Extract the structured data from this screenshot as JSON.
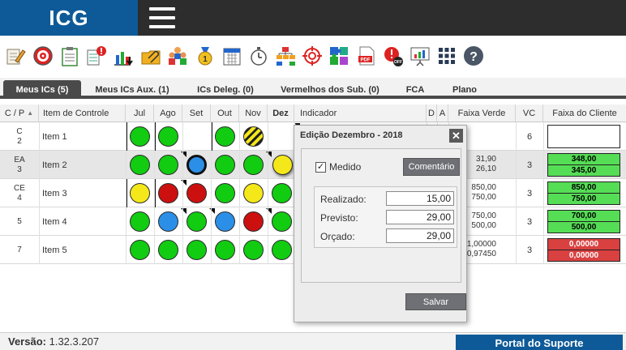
{
  "app": {
    "logo": "ICG"
  },
  "toolbar": {
    "icons": [
      "edit-icon",
      "target-icon",
      "clipboard-icon",
      "alert-chart-icon",
      "bar-chart-icon",
      "folder-clip-icon",
      "team-icon",
      "medal-icon",
      "calendar-icon",
      "stopwatch-icon",
      "org-chart-icon",
      "crosshair-icon",
      "puzzle-icon",
      "pdf-icon",
      "alert-off-icon",
      "presentation-icon",
      "grid-icon",
      "help-icon"
    ]
  },
  "tabs": [
    {
      "label": "Meus ICs (5)",
      "active": true
    },
    {
      "label": "Meus ICs Aux. (1)",
      "active": false
    },
    {
      "label": "ICs Deleg. (0)",
      "active": false
    },
    {
      "label": "Vermelhos dos Sub. (0)",
      "active": false
    },
    {
      "label": "FCA",
      "active": false
    },
    {
      "label": "Plano",
      "active": false
    }
  ],
  "grid": {
    "columns": {
      "cp": "C / P",
      "item": "Item de Controle",
      "jul": "Jul",
      "ago": "Ago",
      "set": "Set",
      "out": "Out",
      "nov": "Nov",
      "dez": "Dez",
      "indicador": "Indicador",
      "d": "D",
      "a": "A",
      "faixa_verde": "Faixa Verde",
      "vc": "VC",
      "faixa_cliente": "Faixa do Cliente"
    },
    "rows": [
      {
        "c": "C",
        "p": "2",
        "item": "Item 1",
        "months": [
          "green",
          "green",
          "empty",
          "green",
          "hatched",
          "empty"
        ],
        "fv": [
          "",
          ""
        ],
        "vc": "6",
        "cliente": {
          "top": "",
          "bottom": "",
          "color": "#ffffff",
          "single": true
        }
      },
      {
        "c": "EA",
        "p": "3",
        "item": "Item 2",
        "months": [
          "green",
          "green",
          "blue-selected",
          "green",
          "green",
          "yellow"
        ],
        "fv": [
          "31,90",
          "26,10"
        ],
        "vc": "3",
        "cliente": {
          "top": "348,00",
          "bottom": "345,00",
          "color": "#55dd55",
          "single": false
        }
      },
      {
        "c": "CE",
        "p": "4",
        "item": "Item 3",
        "months": [
          "yellow",
          "red",
          "red",
          "green",
          "yellow",
          "green"
        ],
        "fv": [
          "850,00",
          "750,00"
        ],
        "vc": "3",
        "cliente": {
          "top": "850,00",
          "bottom": "750,00",
          "color": "#55dd55",
          "single": false
        }
      },
      {
        "c": "",
        "p": "5",
        "item": "Item 4",
        "months": [
          "green",
          "blue",
          "green",
          "blue",
          "red",
          "green"
        ],
        "fv": [
          "750,00",
          "500,00"
        ],
        "vc": "3",
        "cliente": {
          "top": "700,00",
          "bottom": "500,00",
          "color": "#55dd55",
          "single": false
        }
      },
      {
        "c": "",
        "p": "7",
        "item": "Item 5",
        "months": [
          "green",
          "green",
          "green",
          "green",
          "green",
          "green"
        ],
        "fv": [
          "1,00000",
          "0,97450"
        ],
        "vc": "3",
        "cliente": {
          "top": "0,00000",
          "bottom": "0,00000",
          "color": "#d94040",
          "single": false
        }
      }
    ]
  },
  "colors": {
    "green": "#11cc11",
    "blue": "#2b8fe8",
    "red": "#cc1010",
    "yellow": "#f5e81a",
    "brand": "#0e5a98"
  },
  "modal": {
    "title": "Edição Dezembro - 2018",
    "close": "✕",
    "medido_label": "Medido",
    "medido_checked": true,
    "comentario": "Comentário",
    "fields": [
      {
        "label": "Realizado:",
        "value": "15,00"
      },
      {
        "label": "Previsto:",
        "value": "29,00"
      },
      {
        "label": "Orçado:",
        "value": "29,00"
      }
    ],
    "salvar": "Salvar"
  },
  "footer": {
    "version_label": "Versão:",
    "version_value": "1.32.3.207",
    "portal": "Portal do Suporte"
  }
}
